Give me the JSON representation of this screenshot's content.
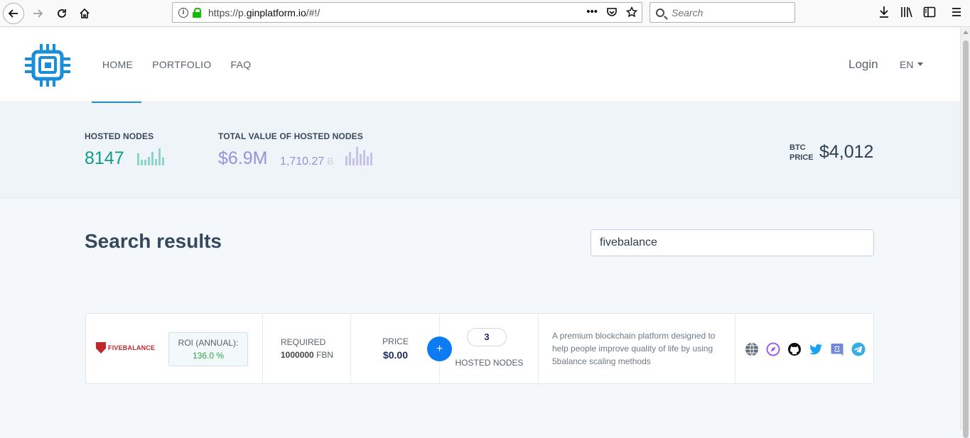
{
  "browser": {
    "url_prefix": "https://p.",
    "url_host": "ginplatform.io",
    "url_path": "/#!/",
    "search_placeholder": "Search",
    "more_label": "•••"
  },
  "nav": {
    "items": [
      {
        "label": "HOME"
      },
      {
        "label": "PORTFOLIO"
      },
      {
        "label": "FAQ"
      }
    ],
    "login": "Login",
    "language": "EN"
  },
  "stats": {
    "hosted_nodes_label": "HOSTED NODES",
    "hosted_nodes_value": "8147",
    "total_value_label": "TOTAL VALUE OF HOSTED NODES",
    "total_value_usd": "$6.9M",
    "total_value_btc": "1,710.27",
    "btc_symbol": "Ƀ",
    "btc_price_label_1": "BTC",
    "btc_price_label_2": "PRICE",
    "btc_price_value": "$4,012"
  },
  "search": {
    "title": "Search results",
    "query": "fivebalance"
  },
  "result": {
    "logo_text": "FIVEBALANCE",
    "roi_label": "ROI (ANNUAL):",
    "roi_value": "136.0 %",
    "required_label": "REQUIRED",
    "required_amount": "1000000",
    "required_unit": "FBN",
    "price_label": "PRICE",
    "price_value": "$0.00",
    "add_label": "+",
    "hosted_nodes_count": "3",
    "hosted_nodes_label": "HOSTED NODES",
    "description": "A premium blockchain platform designed to help people improve quality of life by using 5balance scaling methods",
    "socials": [
      "globe-icon",
      "compass-icon",
      "github-icon",
      "twitter-icon",
      "discord-icon",
      "telegram-icon"
    ]
  },
  "colors": {
    "accent": "#1a8fd8",
    "teal": "#139b8a",
    "purple": "#9b8fdc",
    "add_button": "#0d7cf2",
    "roi_green": "#28a745",
    "brand_red": "#c0272d"
  }
}
